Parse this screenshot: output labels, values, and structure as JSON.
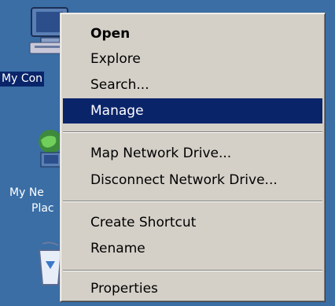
{
  "desktop": {
    "icons": [
      {
        "name": "My Computer",
        "label_visible": "My Con",
        "selected": true
      },
      {
        "name": "My Network Places",
        "label_line1": "My Ne",
        "label_line2": "Plac"
      },
      {
        "name": "Recycle Bin"
      }
    ]
  },
  "context_menu": {
    "items": [
      {
        "label": "Open",
        "bold": true
      },
      {
        "label": "Explore"
      },
      {
        "label": "Search..."
      },
      {
        "label": "Manage",
        "highlighted": true
      },
      {
        "label": "Map Network Drive..."
      },
      {
        "label": "Disconnect Network Drive..."
      },
      {
        "label": "Create Shortcut"
      },
      {
        "label": "Rename"
      },
      {
        "label": "Properties"
      }
    ]
  },
  "colors": {
    "desktop": "#3a6ea5",
    "menu": "#d4d0c8",
    "highlight": "#0a246a"
  }
}
